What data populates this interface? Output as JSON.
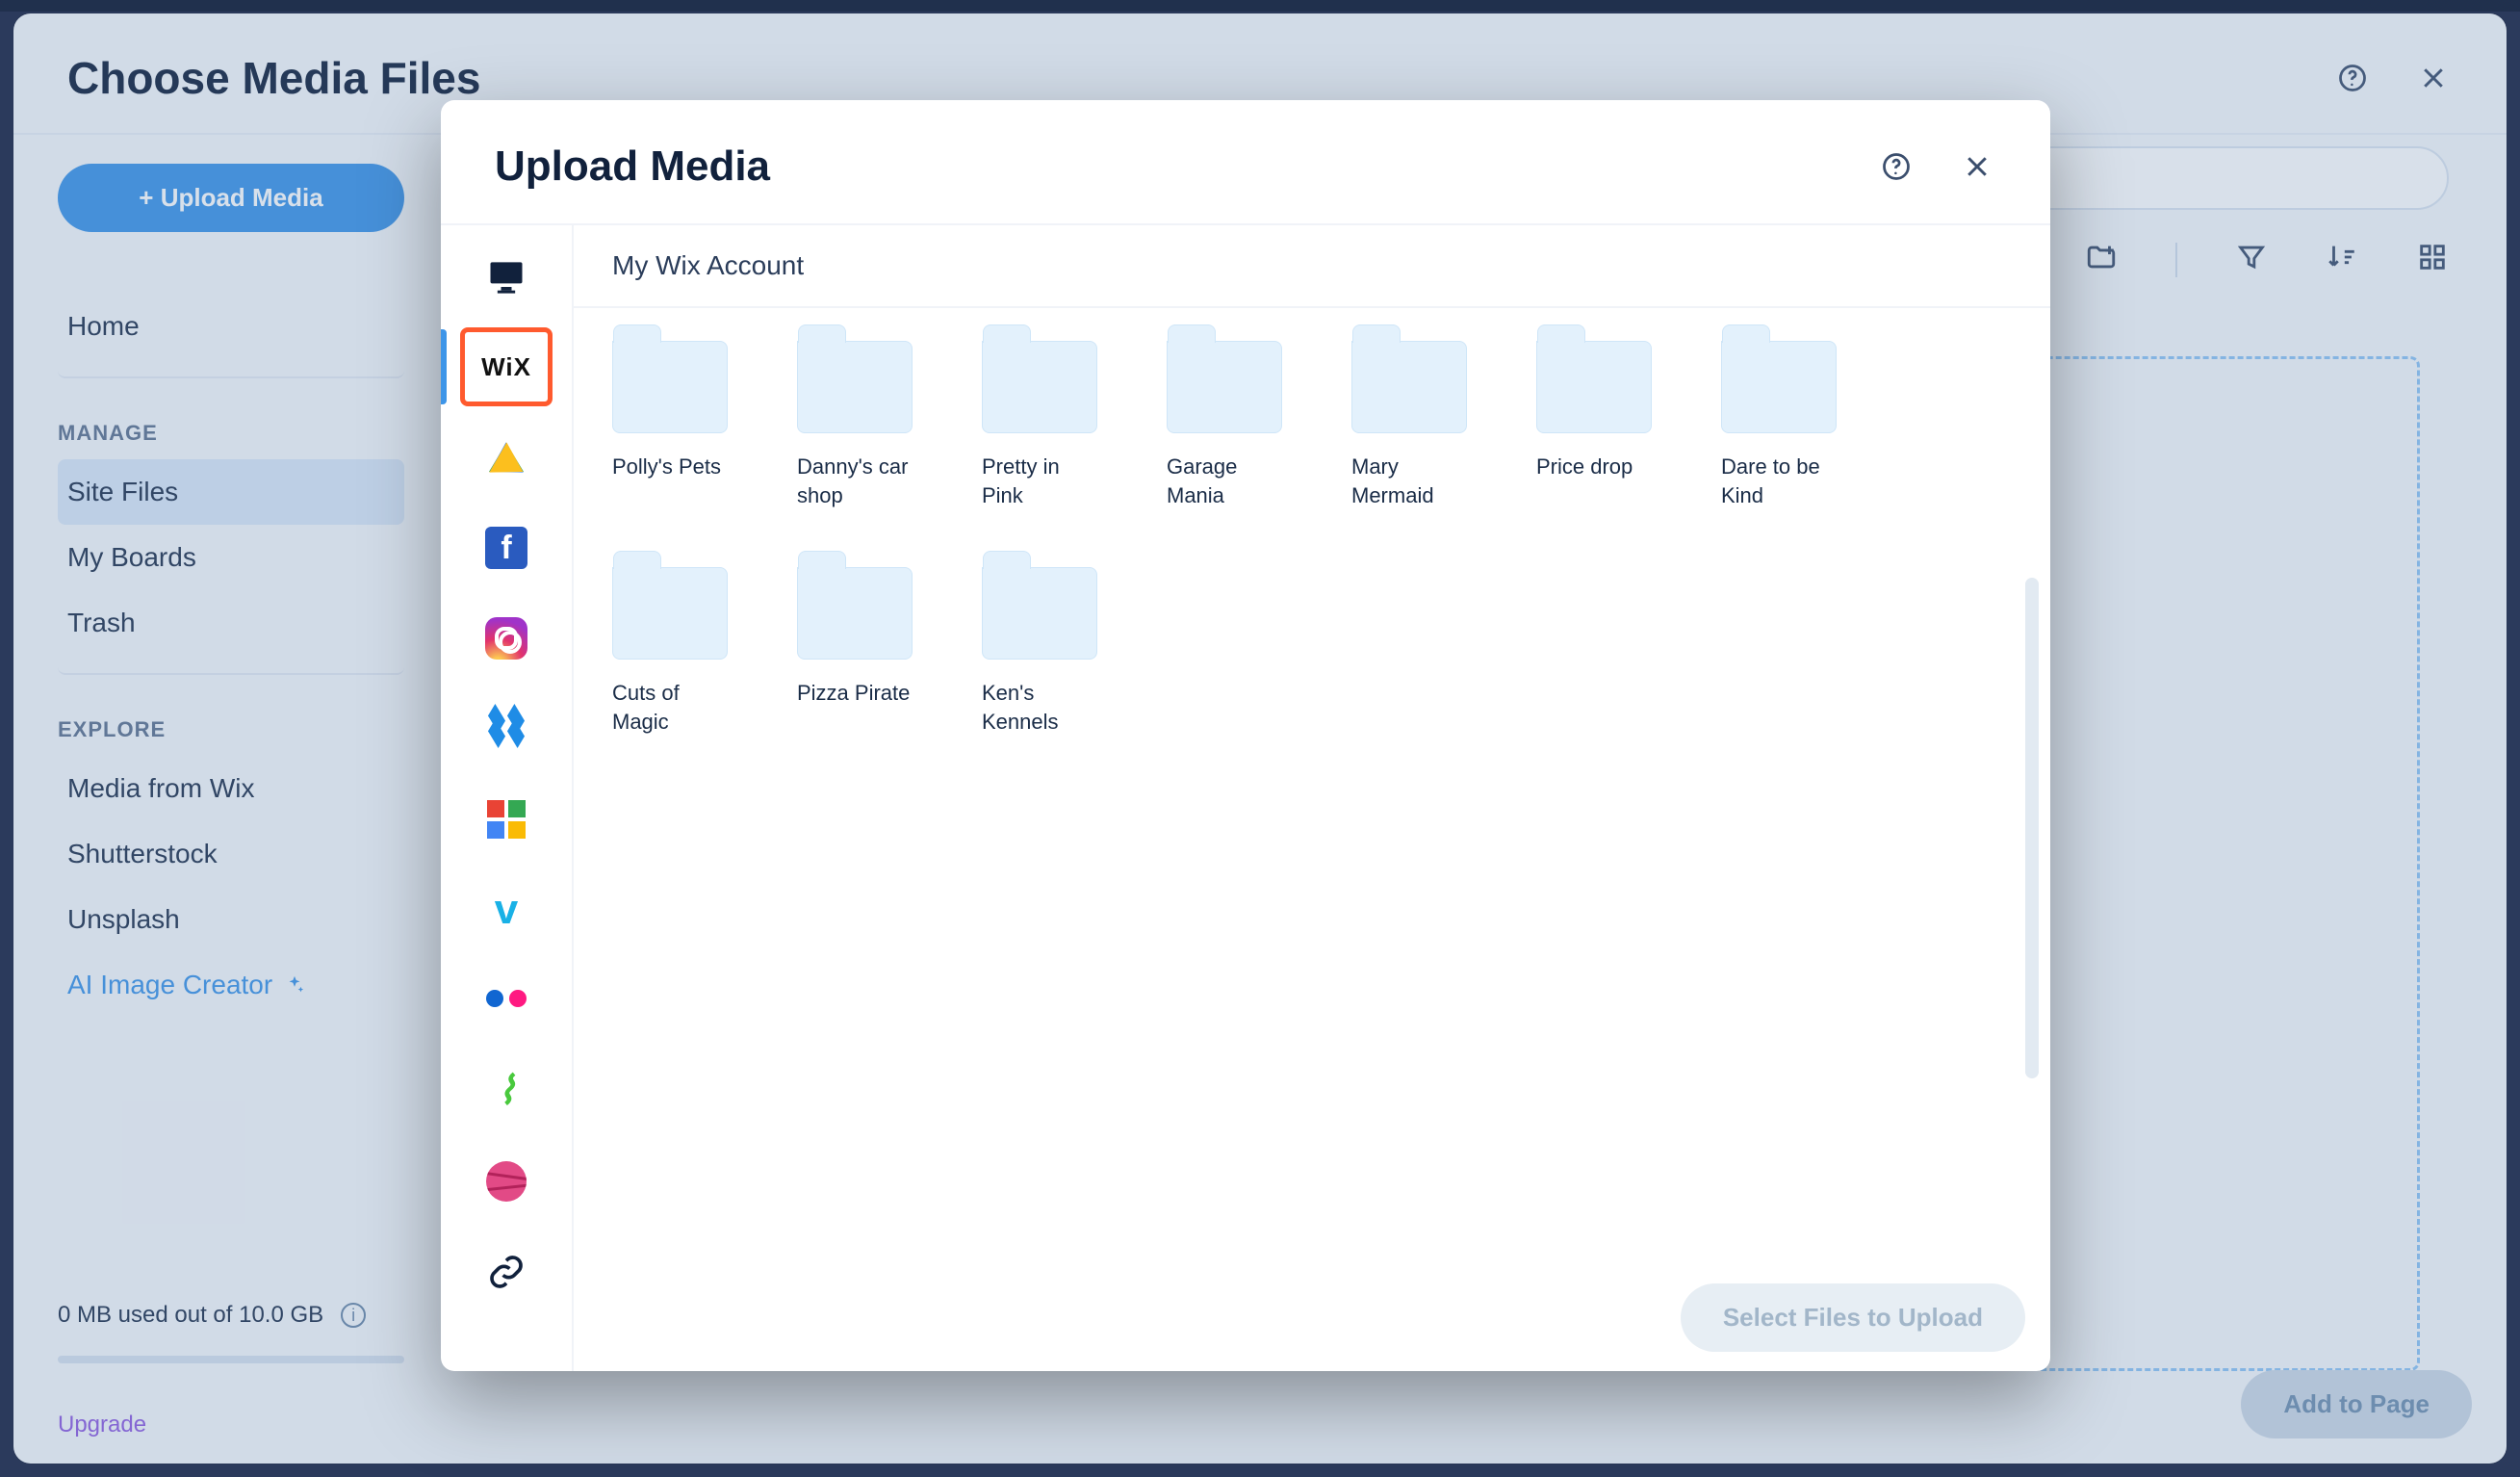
{
  "outer": {
    "title": "Choose Media Files",
    "upload_button": "+ Upload Media",
    "nav_home": "Home",
    "manage_label": "MANAGE",
    "manage_items": [
      "Site Files",
      "My Boards",
      "Trash"
    ],
    "manage_active_index": 0,
    "explore_label": "EXPLORE",
    "explore_items": [
      "Media from Wix",
      "Shutterstock",
      "Unsplash"
    ],
    "ai_link": "AI Image Creator",
    "storage_line": "0 MB used out of 10.0 GB",
    "upgrade_link": "Upgrade",
    "add_to_page": "Add to Page"
  },
  "inner": {
    "title": "Upload Media",
    "crumb": "My Wix Account",
    "select_button": "Select Files to Upload",
    "sources": [
      {
        "id": "desktop",
        "label": "Desktop"
      },
      {
        "id": "wix",
        "label": "Wix"
      },
      {
        "id": "gdrive",
        "label": "Google Drive"
      },
      {
        "id": "facebook",
        "label": "Facebook"
      },
      {
        "id": "instagram",
        "label": "Instagram"
      },
      {
        "id": "dropbox",
        "label": "Dropbox"
      },
      {
        "id": "gphotos",
        "label": "Google Photos"
      },
      {
        "id": "vimeo",
        "label": "Vimeo"
      },
      {
        "id": "flickr",
        "label": "Flickr"
      },
      {
        "id": "deviantart",
        "label": "DeviantArt"
      },
      {
        "id": "dribbble",
        "label": "Dribbble"
      },
      {
        "id": "link",
        "label": "Link"
      }
    ],
    "selected_source_index": 1,
    "highlighted_source_index": 1,
    "folders": [
      "Polly's Pets",
      "Danny's car shop",
      "Pretty in Pink",
      "Garage Mania",
      "Mary Mermaid",
      "Price drop",
      "Dare to be Kind",
      "Cuts of Magic",
      "Pizza Pirate",
      "Ken's Kennels"
    ]
  }
}
